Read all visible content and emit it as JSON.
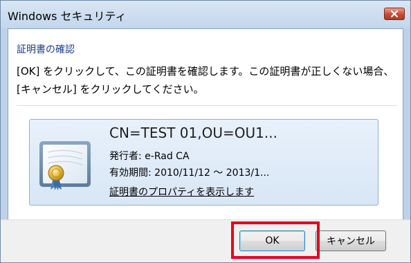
{
  "window": {
    "title": "Windows セキュリティ"
  },
  "dialog": {
    "heading": "証明書の確認",
    "message": "[OK] をクリックして、この証明書を確認します。この証明書が正しくない場合、[キャンセル] をクリックしてください。"
  },
  "certificate": {
    "name": "CN=TEST 01,OU=OU1...",
    "issuer": "発行者: e-Rad CA",
    "validity": "有効期間: 2010/11/12 ～ 2013/1...",
    "properties_link": "証明書のプロパティを表示します",
    "icon": "certificate-icon"
  },
  "buttons": {
    "ok_label": "OK",
    "cancel_label": "キャンセル"
  },
  "colors": {
    "heading": "#1a3c8c",
    "highlight": "#e8001c",
    "close_button": "#c74a31"
  }
}
